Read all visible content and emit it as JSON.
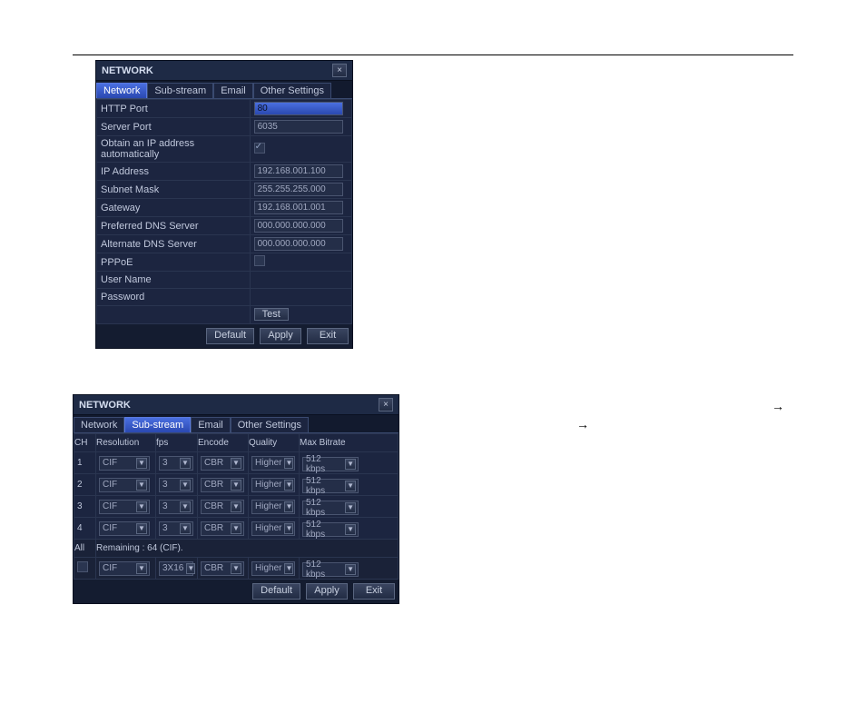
{
  "arrow1": "→",
  "arrow2": "→",
  "panel1": {
    "title": "NETWORK",
    "close": "×",
    "tabs": [
      "Network",
      "Sub-stream",
      "Email",
      "Other Settings"
    ],
    "active_tab": 0,
    "rows": {
      "http_port": {
        "label": "HTTP Port",
        "value": "80"
      },
      "server_port": {
        "label": "Server Port",
        "value": "6035"
      },
      "dhcp": {
        "label": "Obtain an IP address automatically",
        "checked": true
      },
      "ip": {
        "label": "IP Address",
        "value": "192.168.001.100"
      },
      "subnet": {
        "label": "Subnet Mask",
        "value": "255.255.255.000"
      },
      "gateway": {
        "label": "Gateway",
        "value": "192.168.001.001"
      },
      "dns1": {
        "label": "Preferred DNS Server",
        "value": "000.000.000.000"
      },
      "dns2": {
        "label": "Alternate DNS Server",
        "value": "000.000.000.000"
      },
      "pppoe": {
        "label": "PPPoE",
        "checked": false
      },
      "user": {
        "label": "User Name",
        "value": ""
      },
      "pass": {
        "label": "Password",
        "value": ""
      },
      "test": {
        "label": "Test"
      }
    },
    "buttons": {
      "default": "Default",
      "apply": "Apply",
      "exit": "Exit"
    }
  },
  "panel2": {
    "title": "NETWORK",
    "close": "×",
    "tabs": [
      "Network",
      "Sub-stream",
      "Email",
      "Other Settings"
    ],
    "active_tab": 1,
    "headers": [
      "CH",
      "Resolution",
      "fps",
      "Encode",
      "Quality",
      "Max Bitrate"
    ],
    "rows": [
      {
        "ch": "1",
        "res": "CIF",
        "fps": "3",
        "enc": "CBR",
        "qual": "Higher",
        "bitrate": "512 kbps"
      },
      {
        "ch": "2",
        "res": "CIF",
        "fps": "3",
        "enc": "CBR",
        "qual": "Higher",
        "bitrate": "512 kbps"
      },
      {
        "ch": "3",
        "res": "CIF",
        "fps": "3",
        "enc": "CBR",
        "qual": "Higher",
        "bitrate": "512 kbps"
      },
      {
        "ch": "4",
        "res": "CIF",
        "fps": "3",
        "enc": "CBR",
        "qual": "Higher",
        "bitrate": "512 kbps"
      }
    ],
    "all_label": "All",
    "remaining": "Remaining : 64 (CIF).",
    "allrow": {
      "res": "CIF",
      "fps": "3X16",
      "enc": "CBR",
      "qual": "Higher",
      "bitrate": "512 kbps"
    },
    "buttons": {
      "default": "Default",
      "apply": "Apply",
      "exit": "Exit"
    }
  }
}
